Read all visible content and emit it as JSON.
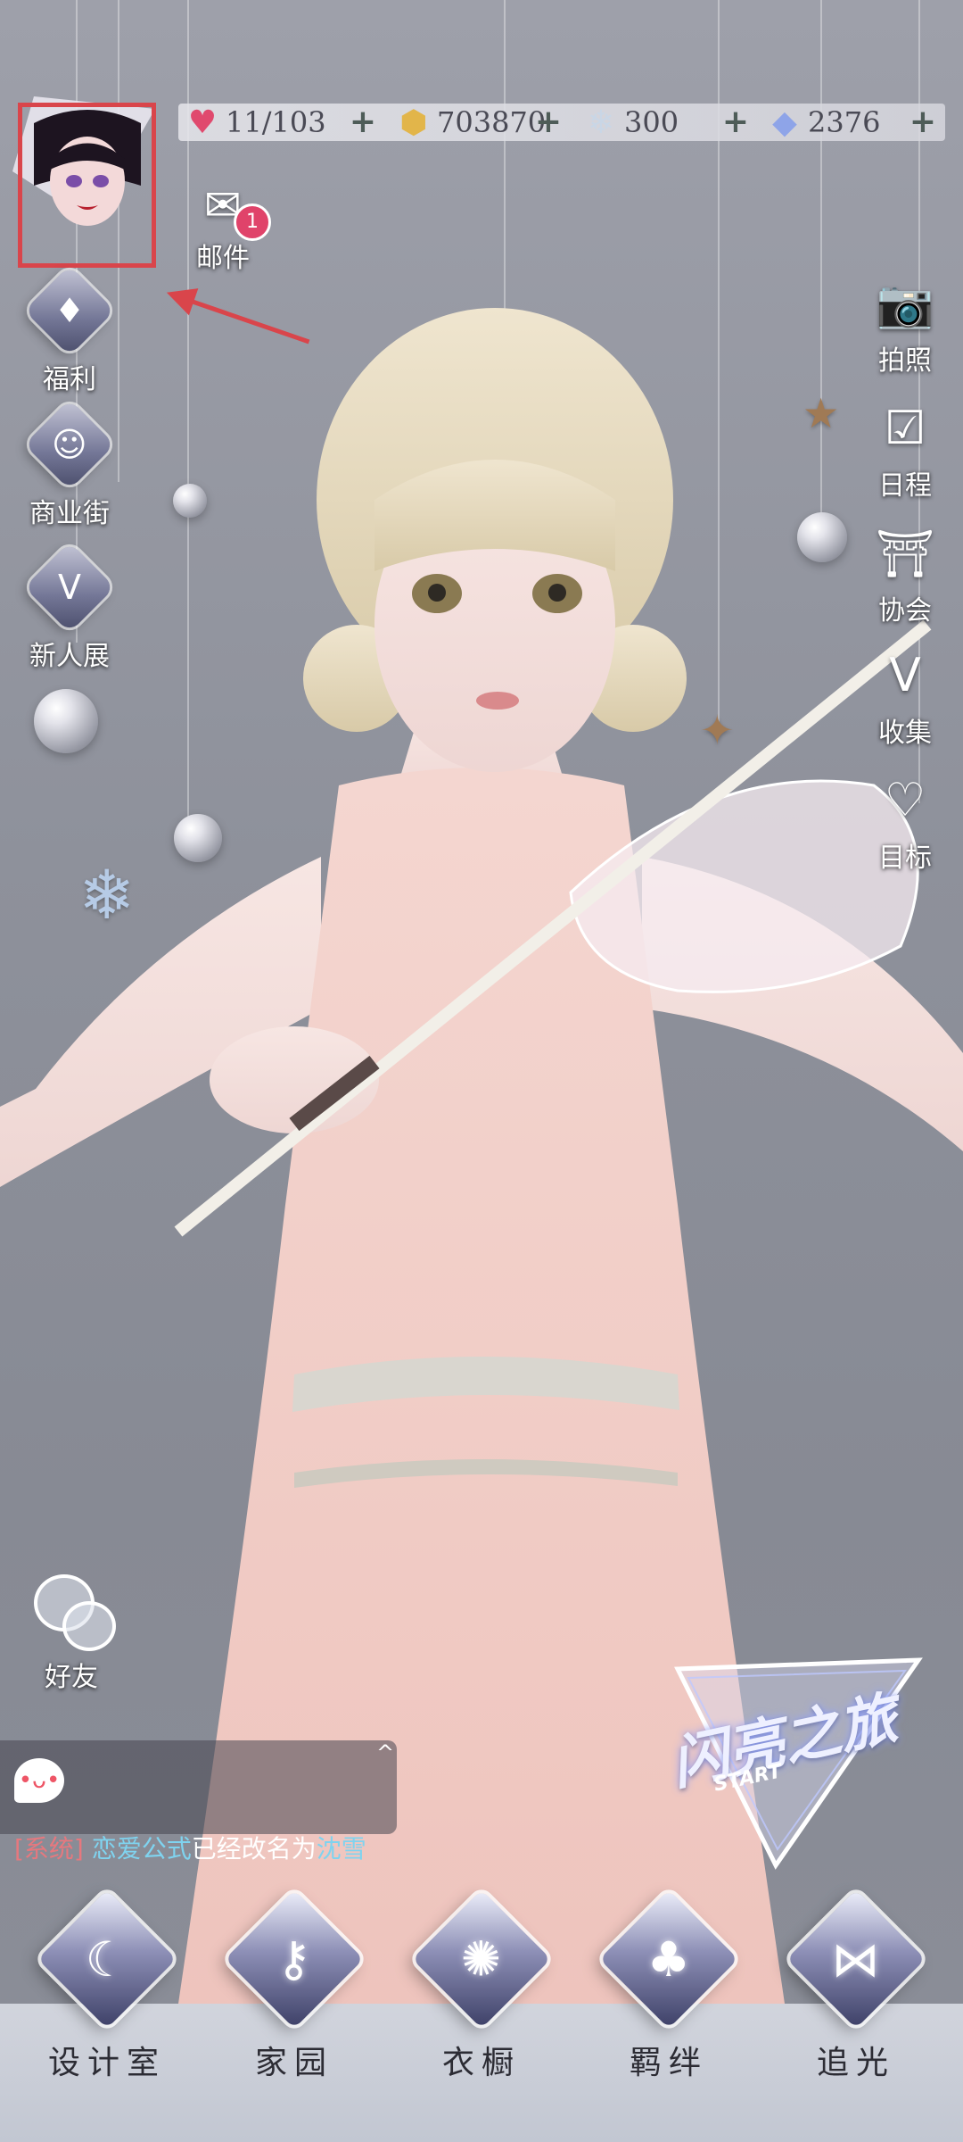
{
  "resources": {
    "hearts": {
      "value": "11/103",
      "icon": "heart-gem-icon",
      "color": "#e04a6e"
    },
    "gold": {
      "value": "703870",
      "icon": "gold-coin-icon",
      "color": "#e2b54a"
    },
    "snow": {
      "value": "300",
      "icon": "snowflake-crystal-icon",
      "color": "#c9d6e6"
    },
    "diamond": {
      "value": "2376",
      "icon": "diamond-icon",
      "color": "#8ea4e8"
    },
    "plus_symbol": "+"
  },
  "mail": {
    "label": "邮件",
    "badge": "1"
  },
  "left_menu": {
    "welfare": "福利",
    "mall": "商业街",
    "newbie": "新人展"
  },
  "right_menu": {
    "photo": "拍照",
    "schedule": "日程",
    "guild": "协会",
    "collect": "收集",
    "goal": "目标"
  },
  "friend": {
    "label": "好友"
  },
  "chat": {
    "tag": "[系统]",
    "name": "恋爱公式",
    "middle": "已经改名为",
    "new_name": "沈雪"
  },
  "journey": {
    "title": "闪亮之旅",
    "sub": "START"
  },
  "bottom_nav": [
    {
      "label": "设计室",
      "icon": "moon-icon"
    },
    {
      "label": "家园",
      "icon": "key-icon"
    },
    {
      "label": "衣橱",
      "icon": "crystal-icon"
    },
    {
      "label": "羁绊",
      "icon": "clover-icon"
    },
    {
      "label": "追光",
      "icon": "butterfly-icon"
    }
  ],
  "colors": {
    "highlight": "#d9454b",
    "accent_blue": "#7fd3ef",
    "system_tag": "#e6787e"
  }
}
